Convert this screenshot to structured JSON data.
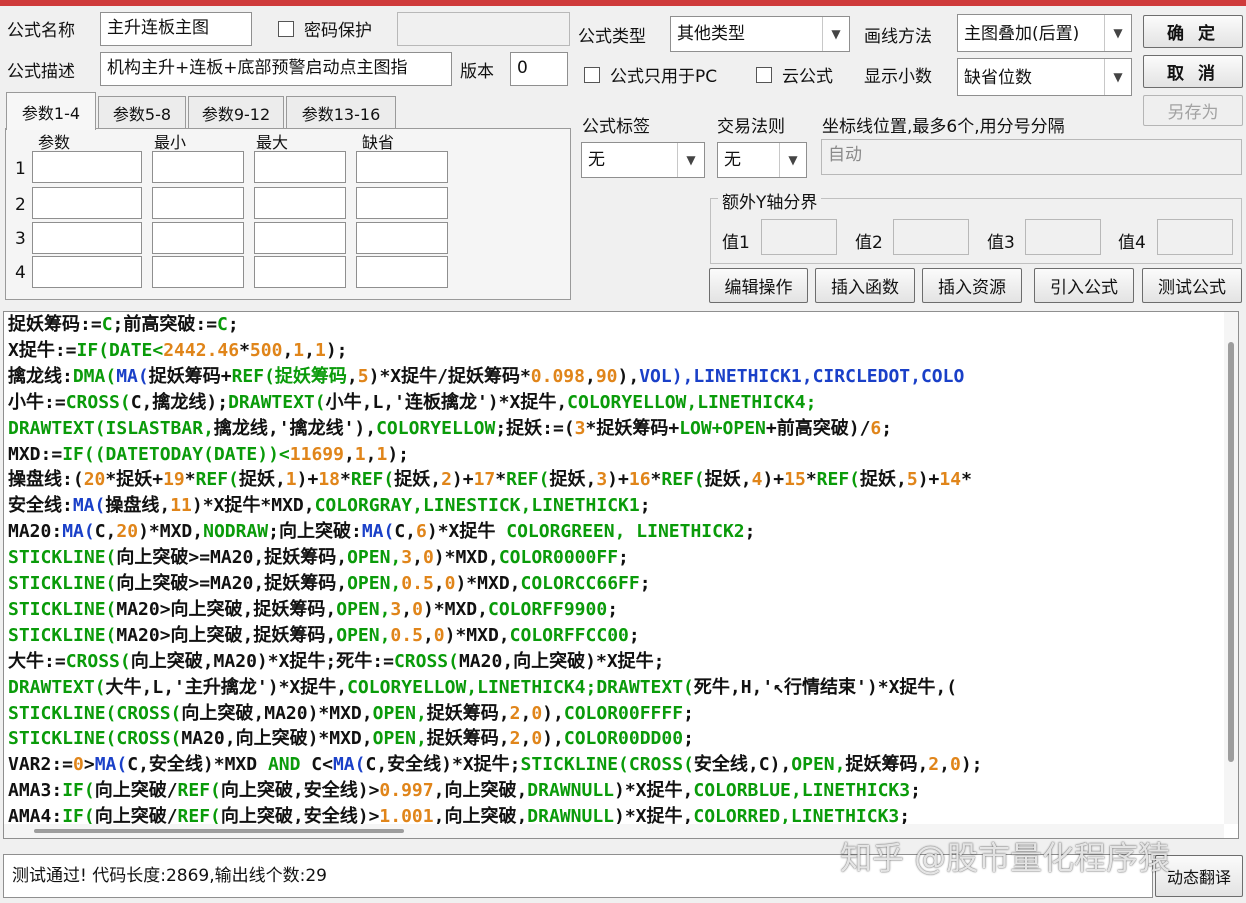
{
  "colors": {
    "green": "#0a9b0a",
    "blue": "#1a40c8",
    "orange": "#e0851a",
    "black": "#111111",
    "red_bar": "#cf3b3b"
  },
  "form": {
    "name_label": "公式名称",
    "name_value": "主升连板主图",
    "password_label": "密码保护",
    "password_value": "",
    "desc_label": "公式描述",
    "desc_value": "机构主升+连板+底部预警启动点主图指",
    "version_label": "版本",
    "version_value": "0",
    "type_label": "公式类型",
    "type_value": "其他类型",
    "draw_label": "画线方法",
    "draw_value": "主图叠加(后置)",
    "pc_only_label": "公式只用于PC",
    "cloud_label": "云公式",
    "decimal_label": "显示小数",
    "decimal_value": "缺省位数",
    "tag_label": "公式标签",
    "tag_value": "无",
    "rule_label": "交易法则",
    "rule_value": "无",
    "axis_label": "坐标线位置,最多6个,用分号分隔",
    "axis_value": "自动",
    "extra_y_label": "额外Y轴分界",
    "v1_label": "值1",
    "v2_label": "值2",
    "v3_label": "值3",
    "v4_label": "值4"
  },
  "buttons": {
    "ok": "确 定",
    "cancel": "取 消",
    "save_as": "另存为",
    "edit": "编辑操作",
    "insert_func": "插入函数",
    "insert_res": "插入资源",
    "import": "引入公式",
    "test": "测试公式",
    "translate": "动态翻译"
  },
  "tabs": [
    "参数1-4",
    "参数5-8",
    "参数9-12",
    "参数13-16"
  ],
  "params": {
    "headers": [
      "参数",
      "最小",
      "最大",
      "缺省"
    ],
    "rows": [
      "1",
      "2",
      "3",
      "4"
    ]
  },
  "code_lines": [
    [
      [
        "捉妖筹码:=",
        "k"
      ],
      [
        "C",
        "g"
      ],
      [
        ";前高突破:=",
        "k"
      ],
      [
        "C",
        "g"
      ],
      [
        ";",
        "k"
      ]
    ],
    [
      [
        "X捉牛:=",
        "k"
      ],
      [
        "IF(DATE<",
        "g"
      ],
      [
        "2442.46",
        "o"
      ],
      [
        "*",
        "k"
      ],
      [
        "500",
        "o"
      ],
      [
        ",",
        "k"
      ],
      [
        "1",
        "o"
      ],
      [
        ",",
        "k"
      ],
      [
        "1",
        "o"
      ],
      [
        ");",
        "k"
      ]
    ],
    [
      [
        "擒龙线:",
        "k"
      ],
      [
        "DMA(",
        "g"
      ],
      [
        "MA(",
        "b"
      ],
      [
        "捉妖筹码+",
        "k"
      ],
      [
        "REF(",
        "g"
      ],
      [
        "捉妖筹码",
        "g"
      ],
      [
        ",",
        "k"
      ],
      [
        "5",
        "o"
      ],
      [
        ")*X捉牛/捉妖筹码*",
        "k"
      ],
      [
        "0.098",
        "o"
      ],
      [
        ",",
        "k"
      ],
      [
        "90",
        "o"
      ],
      [
        "),",
        "k"
      ],
      [
        "VOL),LINETHICK1,CIRCLEDOT,COLO",
        "b"
      ]
    ],
    [
      [
        "小牛:=",
        "k"
      ],
      [
        "CROSS(",
        "g"
      ],
      [
        "C,擒龙线);",
        "k"
      ],
      [
        "DRAWTEXT(",
        "g"
      ],
      [
        "小牛,L,'连板擒龙')*X捉牛,",
        "k"
      ],
      [
        "COLORYELLOW,LINETHICK4;",
        "g"
      ]
    ],
    [
      [
        "DRAWTEXT(ISLASTBAR,",
        "g"
      ],
      [
        "擒龙线,'擒龙线'),",
        "k"
      ],
      [
        "COLORYELLOW",
        "g"
      ],
      [
        ";捉妖:=(",
        "k"
      ],
      [
        "3",
        "o"
      ],
      [
        "*捉妖筹码+",
        "k"
      ],
      [
        "LOW+OPEN",
        "g"
      ],
      [
        "+前高突破)/",
        "k"
      ],
      [
        "6",
        "o"
      ],
      [
        ";",
        "k"
      ]
    ],
    [
      [
        "MXD:=",
        "k"
      ],
      [
        "IF((DATETODAY(DATE))<",
        "g"
      ],
      [
        "11699",
        "o"
      ],
      [
        ",",
        "k"
      ],
      [
        "1",
        "o"
      ],
      [
        ",",
        "k"
      ],
      [
        "1",
        "o"
      ],
      [
        ");",
        "k"
      ]
    ],
    [
      [
        "操盘线:(",
        "k"
      ],
      [
        "20",
        "o"
      ],
      [
        "*捉妖+",
        "k"
      ],
      [
        "19",
        "o"
      ],
      [
        "*",
        "k"
      ],
      [
        "REF(",
        "g"
      ],
      [
        "捉妖,",
        "k"
      ],
      [
        "1",
        "o"
      ],
      [
        ")+",
        "k"
      ],
      [
        "18",
        "o"
      ],
      [
        "*",
        "k"
      ],
      [
        "REF(",
        "g"
      ],
      [
        "捉妖,",
        "k"
      ],
      [
        "2",
        "o"
      ],
      [
        ")+",
        "k"
      ],
      [
        "17",
        "o"
      ],
      [
        "*",
        "k"
      ],
      [
        "REF(",
        "g"
      ],
      [
        "捉妖,",
        "k"
      ],
      [
        "3",
        "o"
      ],
      [
        ")+",
        "k"
      ],
      [
        "16",
        "o"
      ],
      [
        "*",
        "k"
      ],
      [
        "REF(",
        "g"
      ],
      [
        "捉妖,",
        "k"
      ],
      [
        "4",
        "o"
      ],
      [
        ")+",
        "k"
      ],
      [
        "15",
        "o"
      ],
      [
        "*",
        "k"
      ],
      [
        "REF(",
        "g"
      ],
      [
        "捉妖,",
        "k"
      ],
      [
        "5",
        "o"
      ],
      [
        ")+",
        "k"
      ],
      [
        "14",
        "o"
      ],
      [
        "*",
        "k"
      ]
    ],
    [
      [
        "安全线:",
        "k"
      ],
      [
        "MA(",
        "b"
      ],
      [
        "操盘线,",
        "k"
      ],
      [
        "11",
        "o"
      ],
      [
        ")*X捉牛*MXD,",
        "k"
      ],
      [
        "COLORGRAY,LINESTICK,LINETHICK1",
        "g"
      ],
      [
        ";",
        "k"
      ]
    ],
    [
      [
        "MA20:",
        "k"
      ],
      [
        "MA(",
        "b"
      ],
      [
        "C,",
        "k"
      ],
      [
        "20",
        "o"
      ],
      [
        ")*MXD,",
        "k"
      ],
      [
        "NODRAW",
        "g"
      ],
      [
        ";向上突破:",
        "k"
      ],
      [
        "MA(",
        "b"
      ],
      [
        "C,",
        "k"
      ],
      [
        "6",
        "o"
      ],
      [
        ")*X捉牛 ",
        "k"
      ],
      [
        "COLORGREEN, LINETHICK2",
        "g"
      ],
      [
        ";",
        "k"
      ]
    ],
    [
      [
        "STICKLINE(",
        "g"
      ],
      [
        "向上突破>=MA20,捉妖筹码,",
        "k"
      ],
      [
        "OPEN,",
        "g"
      ],
      [
        "3",
        "o"
      ],
      [
        ",",
        "k"
      ],
      [
        "0",
        "o"
      ],
      [
        ")*MXD,",
        "k"
      ],
      [
        "COLOR0000FF",
        "g"
      ],
      [
        ";",
        "k"
      ]
    ],
    [
      [
        "STICKLINE(",
        "g"
      ],
      [
        "向上突破>=MA20,捉妖筹码,",
        "k"
      ],
      [
        "OPEN,",
        "g"
      ],
      [
        "0.5",
        "o"
      ],
      [
        ",",
        "k"
      ],
      [
        "0",
        "o"
      ],
      [
        ")*MXD,",
        "k"
      ],
      [
        "COLORCC66FF",
        "g"
      ],
      [
        ";",
        "k"
      ]
    ],
    [
      [
        "STICKLINE(",
        "g"
      ],
      [
        "MA20>向上突破,捉妖筹码,",
        "k"
      ],
      [
        "OPEN,",
        "g"
      ],
      [
        "3",
        "o"
      ],
      [
        ",",
        "k"
      ],
      [
        "0",
        "o"
      ],
      [
        ")*MXD,",
        "k"
      ],
      [
        "COLORFF9900",
        "g"
      ],
      [
        ";",
        "k"
      ]
    ],
    [
      [
        "STICKLINE(",
        "g"
      ],
      [
        "MA20>向上突破,捉妖筹码,",
        "k"
      ],
      [
        "OPEN,",
        "g"
      ],
      [
        "0.5",
        "o"
      ],
      [
        ",",
        "k"
      ],
      [
        "0",
        "o"
      ],
      [
        ")*MXD,",
        "k"
      ],
      [
        "COLORFFCC00",
        "g"
      ],
      [
        ";",
        "k"
      ]
    ],
    [
      [
        "大牛:=",
        "k"
      ],
      [
        "CROSS(",
        "g"
      ],
      [
        "向上突破,MA20)*X捉牛;死牛:=",
        "k"
      ],
      [
        "CROSS(",
        "g"
      ],
      [
        "MA20,向上突破)*X捉牛;",
        "k"
      ]
    ],
    [
      [
        "DRAWTEXT(",
        "g"
      ],
      [
        "大牛,L,'主升擒龙')*X捉牛,",
        "k"
      ],
      [
        "COLORYELLOW,LINETHICK4;DRAWTEXT(",
        "g"
      ],
      [
        "死牛,H,'↖行情结束')*X捉牛,(",
        "k"
      ]
    ],
    [
      [
        "STICKLINE(CROSS(",
        "g"
      ],
      [
        "向上突破,MA20)*MXD,",
        "k"
      ],
      [
        "OPEN,",
        "g"
      ],
      [
        "捉妖筹码,",
        "k"
      ],
      [
        "2",
        "o"
      ],
      [
        ",",
        "k"
      ],
      [
        "0",
        "o"
      ],
      [
        "),",
        "k"
      ],
      [
        "COLOR00FFFF",
        "g"
      ],
      [
        ";",
        "k"
      ]
    ],
    [
      [
        "STICKLINE(CROSS(",
        "g"
      ],
      [
        "MA20,向上突破)*MXD,",
        "k"
      ],
      [
        "OPEN,",
        "g"
      ],
      [
        "捉妖筹码,",
        "k"
      ],
      [
        "2",
        "o"
      ],
      [
        ",",
        "k"
      ],
      [
        "0",
        "o"
      ],
      [
        "),",
        "k"
      ],
      [
        "COLOR00DD00",
        "g"
      ],
      [
        ";",
        "k"
      ]
    ],
    [
      [
        "VAR2:=",
        "k"
      ],
      [
        "0",
        "o"
      ],
      [
        ">",
        "k"
      ],
      [
        "MA(",
        "b"
      ],
      [
        "C,安全线)*MXD ",
        "k"
      ],
      [
        "AND",
        "g"
      ],
      [
        " C<",
        "k"
      ],
      [
        "MA(",
        "b"
      ],
      [
        "C,安全线)*X捉牛;",
        "k"
      ],
      [
        "STICKLINE(CROSS(",
        "g"
      ],
      [
        "安全线,C),",
        "k"
      ],
      [
        "OPEN,",
        "g"
      ],
      [
        "捉妖筹码,",
        "k"
      ],
      [
        "2",
        "o"
      ],
      [
        ",",
        "k"
      ],
      [
        "0",
        "o"
      ],
      [
        ");",
        "k"
      ]
    ],
    [
      [
        "AMA3:",
        "k"
      ],
      [
        "IF(",
        "g"
      ],
      [
        "向上突破/",
        "k"
      ],
      [
        "REF(",
        "g"
      ],
      [
        "向上突破,安全线)>",
        "k"
      ],
      [
        "0.997",
        "o"
      ],
      [
        ",向上突破,",
        "k"
      ],
      [
        "DRAWNULL",
        "g"
      ],
      [
        ")*X捉牛,",
        "k"
      ],
      [
        "COLORBLUE,LINETHICK3",
        "g"
      ],
      [
        ";",
        "k"
      ]
    ],
    [
      [
        "AMA4:",
        "k"
      ],
      [
        "IF(",
        "g"
      ],
      [
        "向上突破/",
        "k"
      ],
      [
        "REF(",
        "g"
      ],
      [
        "向上突破,安全线)>",
        "k"
      ],
      [
        "1.001",
        "o"
      ],
      [
        ",向上突破,",
        "k"
      ],
      [
        "DRAWNULL",
        "g"
      ],
      [
        ")*X捉牛,",
        "k"
      ],
      [
        "COLORRED,LINETHICK3",
        "g"
      ],
      [
        ";",
        "k"
      ]
    ]
  ],
  "status": "测试通过! 代码长度:2869,输出线个数:29",
  "watermark": "知乎 @股市量化程序猿"
}
